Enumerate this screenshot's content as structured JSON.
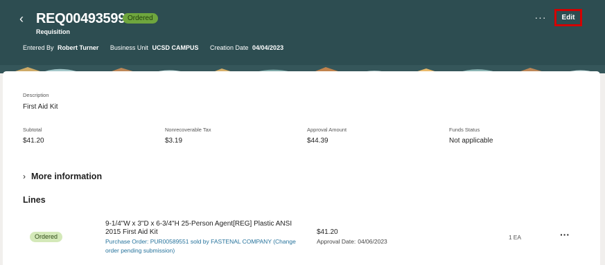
{
  "header": {
    "back_glyph": "‹",
    "title": "REQ00493599",
    "status": "Ordered",
    "subtitle": "Requisition",
    "overflow_glyph": "···",
    "edit_label": "Edit",
    "meta": [
      {
        "label": "Entered By",
        "value": "Robert Turner"
      },
      {
        "label": "Business Unit",
        "value": "UCSD CAMPUS"
      },
      {
        "label": "Creation Date",
        "value": "04/04/2023"
      }
    ]
  },
  "details": {
    "description_label": "Description",
    "description_value": "First Aid Kit",
    "fields": [
      {
        "label": "Subtotal",
        "value": "$41.20"
      },
      {
        "label": "Nonrecoverable Tax",
        "value": "$3.19"
      },
      {
        "label": "Approval Amount",
        "value": "$44.39"
      },
      {
        "label": "Funds Status",
        "value": "Not applicable"
      }
    ]
  },
  "more_info": {
    "chevron": "›",
    "label": "More information"
  },
  "lines": {
    "title": "Lines",
    "items": [
      {
        "status": "Ordered",
        "description": "9-1/4\"W x 3\"D x 6-3/4\"H 25-Person Agent[REG] Plastic ANSI 2015 First Aid Kit",
        "po_text": "Purchase Order: PUR00589551 sold by FASTENAL COMPANY (Change order pending submission)",
        "amount": "$41.20",
        "approval_date_label": "Approval Date:",
        "approval_date": "04/06/2023",
        "quantity": "1",
        "uom": "EA",
        "more_glyph": "···"
      }
    ]
  },
  "colors": {
    "header_bg": "#2d4d51",
    "status_pill_bg": "#6fa63e",
    "row_pill_bg": "#d4e9b9",
    "edit_highlight": "#d40000",
    "link": "#26739c"
  },
  "icons": {
    "back": "chevron-left-icon",
    "overflow": "more-horizontal-icon",
    "expand": "chevron-right-icon",
    "row_overflow": "more-horizontal-icon"
  }
}
